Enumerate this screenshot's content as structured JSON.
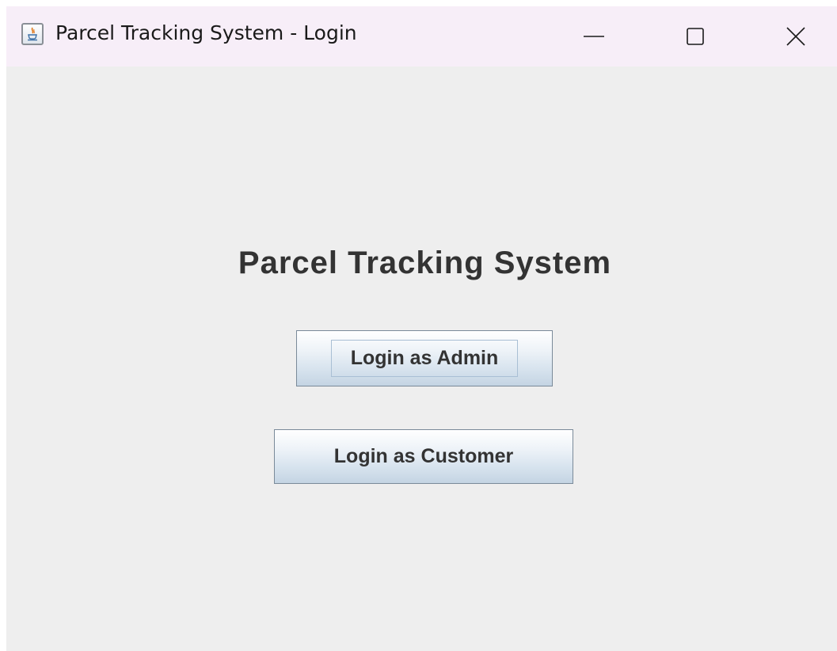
{
  "window": {
    "title": "Parcel Tracking System - Login",
    "app_icon": "java-icon",
    "controls": [
      "minimize-icon",
      "maximize-icon",
      "close-icon"
    ]
  },
  "main": {
    "heading": "Parcel Tracking System",
    "admin_button_label": "Login as Admin",
    "customer_button_label": "Login as Customer",
    "focused_button": "Login as Admin"
  },
  "colors": {
    "background": "#eeeeee",
    "titlebar": "#f7eef8",
    "heading_text": "#333333",
    "button_border": "#7a8a99",
    "button_gradient_bottom": "#c4d4e3"
  }
}
